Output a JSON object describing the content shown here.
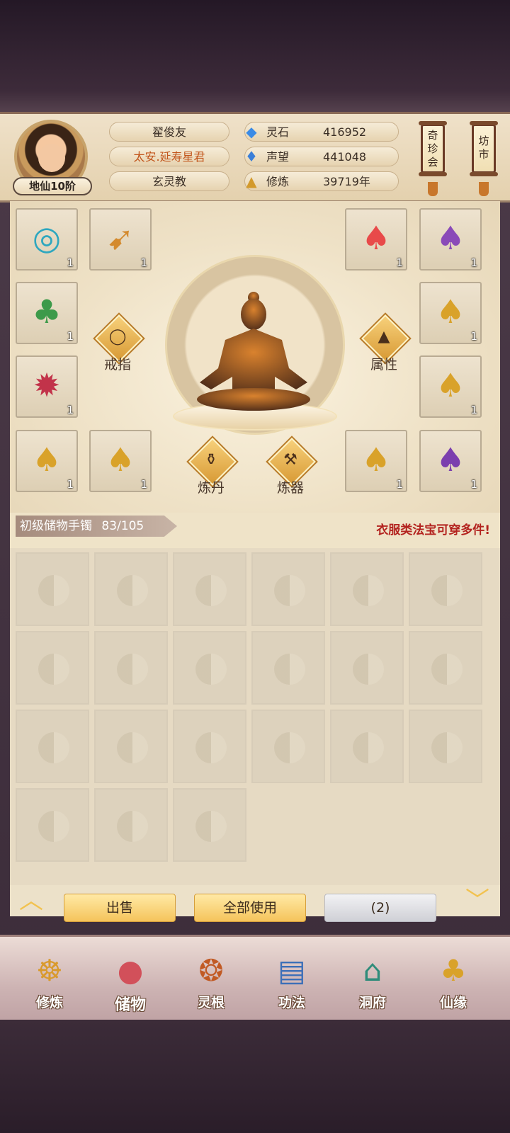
{
  "player": {
    "name": "翟俊友",
    "title": "太安.延寿星君",
    "sect": "玄灵教",
    "rank": "地仙10阶"
  },
  "resources": [
    {
      "label": "灵石",
      "value": "416952",
      "icon": "blue-crystal-icon"
    },
    {
      "label": "声望",
      "value": "441048",
      "icon": "blue-flame-icon"
    },
    {
      "label": "修炼",
      "value": "39719年",
      "icon": "meditation-icon"
    }
  ],
  "side_buttons": [
    {
      "label": "奇\n珍\n会"
    },
    {
      "label": "坊\n市"
    }
  ],
  "equipment": {
    "slots": [
      {
        "icon": "ring-bracelet-icon",
        "count": "1"
      },
      {
        "icon": "bow-icon",
        "count": "1"
      },
      {
        "icon": "red-robe-icon",
        "count": "1"
      },
      {
        "icon": "purple-robe-icon",
        "count": "1"
      },
      {
        "icon": "green-leaf-robe-icon",
        "count": "1"
      },
      {
        "icon": "golden-robe-icon",
        "count": "1"
      },
      {
        "icon": "red-dragon-claw-icon",
        "count": "1"
      },
      {
        "icon": "golden-robe-icon",
        "count": "1"
      },
      {
        "icon": "golden-robe-icon",
        "count": "1"
      },
      {
        "icon": "golden-robe-icon",
        "count": "1"
      },
      {
        "icon": "golden-robe-icon",
        "count": "1"
      },
      {
        "icon": "purple-robe-icon",
        "count": "1"
      }
    ],
    "actions": {
      "ring": "戒指",
      "attributes": "属性",
      "alchemy": "炼丹",
      "forging": "炼器"
    }
  },
  "bag": {
    "name": "初级储物手镯",
    "capacity": "83/105",
    "tip": "衣服类法宝可穿多件!"
  },
  "buttons": {
    "sell": "出售",
    "use_all": "全部使用",
    "page": "(2)"
  },
  "nav": [
    {
      "label": "修炼",
      "icon": "cultivator-icon"
    },
    {
      "label": "储物",
      "icon": "bag-icon"
    },
    {
      "label": "灵根",
      "icon": "spirit-root-icon"
    },
    {
      "label": "功法",
      "icon": "book-icon"
    },
    {
      "label": "洞府",
      "icon": "mansion-icon"
    },
    {
      "label": "仙缘",
      "icon": "gourd-icon"
    }
  ]
}
